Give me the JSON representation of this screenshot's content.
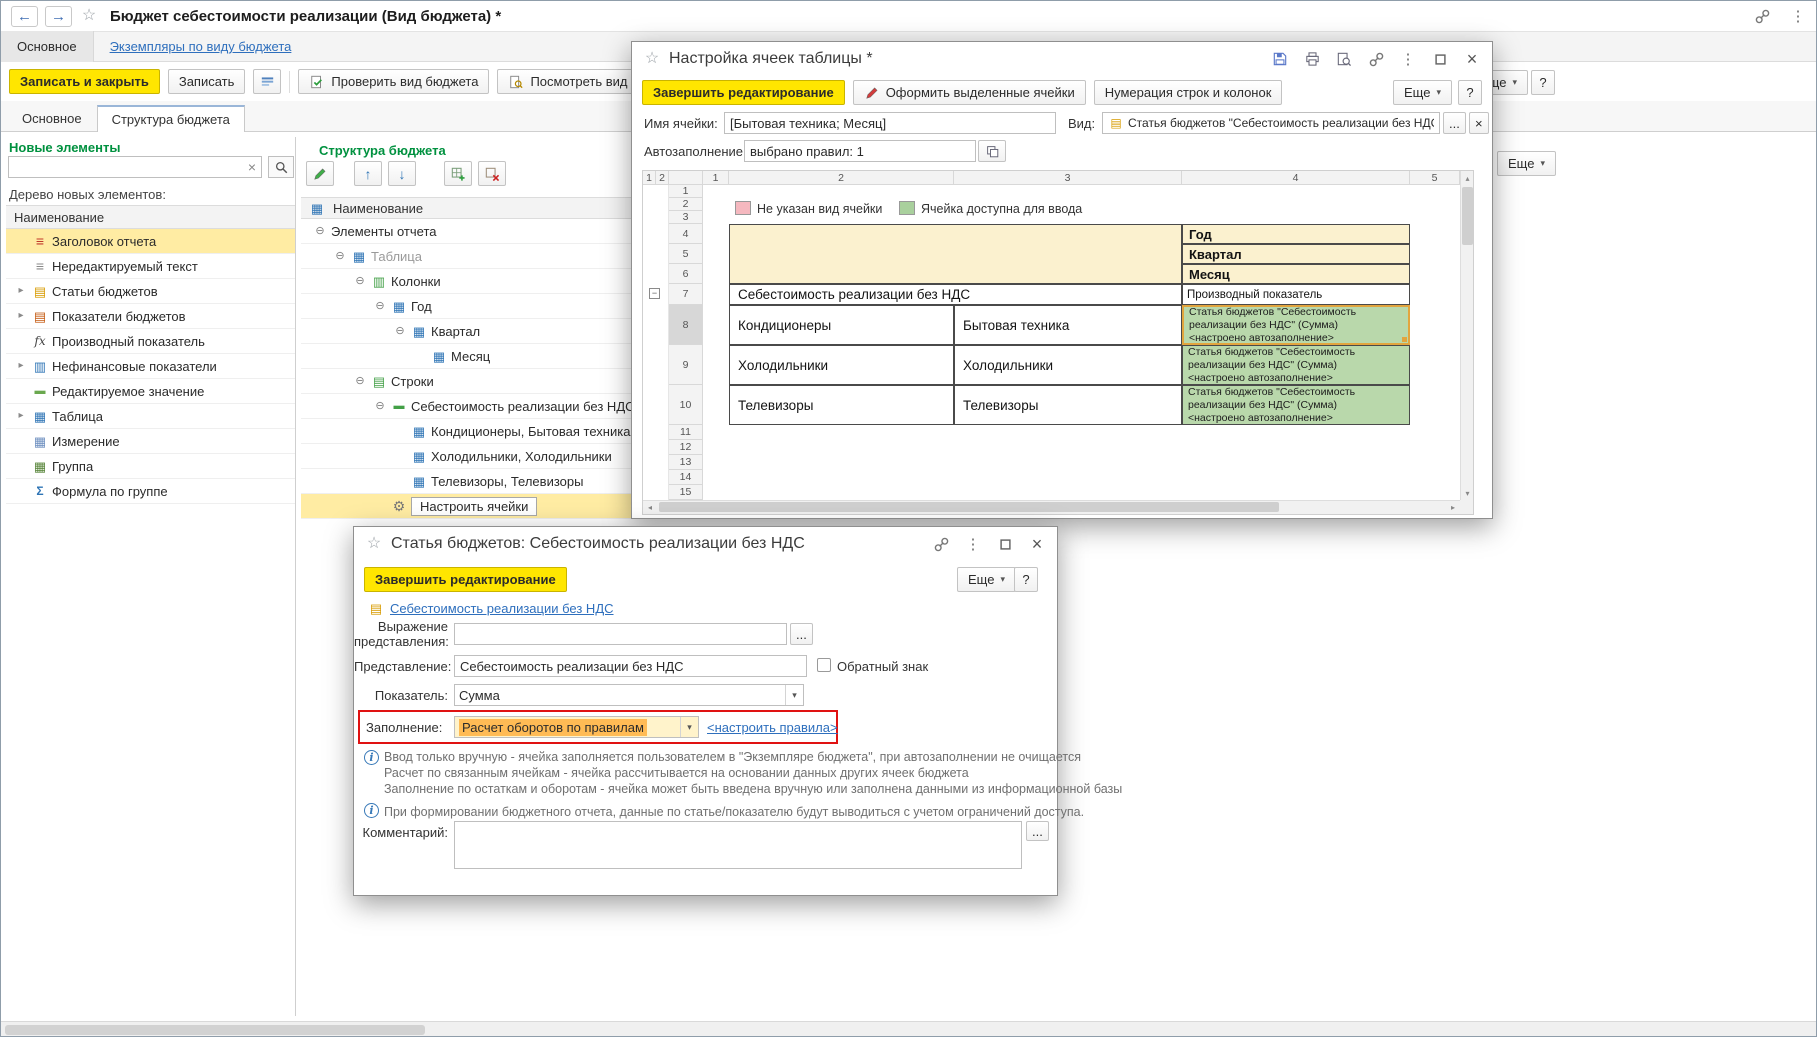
{
  "colors": {
    "accent_yellow": "#ffe600",
    "link_blue": "#2e6fbd",
    "section_green": "#00913f",
    "row_highlight": "#ffeca3",
    "cell_green": "#b9d8ab",
    "cell_pink": "#f5b8bf",
    "period_yellow": "#fbf1cf",
    "attention_red": "#e01212",
    "combo_highlight": "#ffbb55"
  },
  "icons": [
    "back-icon",
    "forward-icon",
    "star-icon",
    "link-icon",
    "menu-dots-icon",
    "search-icon",
    "clear-icon",
    "edit-pencil-icon",
    "move-up-icon",
    "move-down-icon",
    "add-row-icon",
    "delete-row-icon",
    "gear-icon",
    "save-icon",
    "print-icon",
    "preview-icon",
    "maximize-icon",
    "close-icon",
    "info-icon",
    "dropdown-icon",
    "copy-icon",
    "format-pencil-icon",
    "report-icon",
    "check-report-icon",
    "view-report-icon",
    "kind-field-icon",
    "expander-icon",
    "chevron-right-icon"
  ],
  "app": {
    "title": "Бюджет себестоимости реализации (Вид бюджета) *",
    "nav_tab": "Основное",
    "instances_link": "Экземпляры по виду бюджета",
    "toolbar": {
      "save_close": "Записать и закрыть",
      "save": "Записать",
      "check_budget": "Проверить вид бюджета",
      "view_report": "Посмотреть вид отчета",
      "more": "Еще",
      "help": "?"
    },
    "tab_main": "Основное",
    "tab_structure": "Структура бюджета"
  },
  "new_elements": {
    "title": "Новые элементы",
    "tree_caption": "Дерево новых элементов:",
    "column_header": "Наименование",
    "items": [
      {
        "label": "Заголовок отчета",
        "icon": "report-header-icon",
        "chevron": false,
        "selected": true
      },
      {
        "label": "Нередактируемый текст",
        "icon": "static-text-icon",
        "chevron": false,
        "selected": false
      },
      {
        "label": "Статьи бюджетов",
        "icon": "budget-articles-icon",
        "chevron": true,
        "selected": false
      },
      {
        "label": "Показатели бюджетов",
        "icon": "budget-indicators-icon",
        "chevron": true,
        "selected": false
      },
      {
        "label": "Производный показатель",
        "icon": "fx-icon",
        "chevron": false,
        "selected": false
      },
      {
        "label": "Нефинансовые показатели",
        "icon": "nonfinancial-icon",
        "chevron": true,
        "selected": false
      },
      {
        "label": "Редактируемое значение",
        "icon": "editable-value-icon",
        "chevron": false,
        "selected": false
      },
      {
        "label": "Таблица",
        "icon": "table-icon",
        "chevron": true,
        "selected": false
      },
      {
        "label": "Измерение",
        "icon": "dimension-icon",
        "chevron": false,
        "selected": false
      },
      {
        "label": "Группа",
        "icon": "group-icon",
        "chevron": false,
        "selected": false
      },
      {
        "label": "Формула по группе",
        "icon": "formula-icon",
        "chevron": false,
        "selected": false
      }
    ]
  },
  "budget_structure": {
    "title": "Структура бюджета",
    "column_header": "Наименование",
    "more": "Еще",
    "rows": [
      {
        "label": "Элементы отчета",
        "level": 0,
        "expander": true,
        "icon": "",
        "muted": false,
        "selected": false,
        "action_box": false
      },
      {
        "label": "Таблица",
        "level": 1,
        "expander": true,
        "icon": "table-icon",
        "muted": true,
        "selected": false,
        "action_box": false
      },
      {
        "label": "Колонки",
        "level": 2,
        "expander": true,
        "icon": "columns-icon",
        "muted": false,
        "selected": false,
        "action_box": false
      },
      {
        "label": "Год",
        "level": 3,
        "expander": true,
        "icon": "grid-icon",
        "muted": false,
        "selected": false,
        "action_box": false
      },
      {
        "label": "Квартал",
        "level": 4,
        "expander": true,
        "icon": "grid-icon",
        "muted": false,
        "selected": false,
        "action_box": false
      },
      {
        "label": "Месяц",
        "level": 5,
        "expander": false,
        "icon": "grid-icon",
        "muted": false,
        "selected": false,
        "action_box": false
      },
      {
        "label": "Строки",
        "level": 2,
        "expander": true,
        "icon": "rows-icon",
        "muted": false,
        "selected": false,
        "action_box": false
      },
      {
        "label": "Себестоимость реализации без НДС",
        "level": 3,
        "expander": true,
        "icon": "article-icon",
        "muted": false,
        "selected": false,
        "action_box": false
      },
      {
        "label": "Кондиционеры, Бытовая техника",
        "level": 4,
        "expander": false,
        "icon": "grid-icon",
        "muted": false,
        "selected": false,
        "action_box": false
      },
      {
        "label": "Холодильники, Холодильники",
        "level": 4,
        "expander": false,
        "icon": "grid-icon",
        "muted": false,
        "selected": false,
        "action_box": false
      },
      {
        "label": "Телевизоры, Телевизоры",
        "level": 4,
        "expander": false,
        "icon": "grid-icon",
        "muted": false,
        "selected": false,
        "action_box": false
      },
      {
        "label": "Настроить ячейки",
        "level": 3,
        "expander": false,
        "icon": "gear-icon",
        "muted": false,
        "selected": true,
        "action_box": true
      }
    ]
  },
  "cells_dialog": {
    "title": "Настройка ячеек таблицы *",
    "finish_button": "Завершить редактирование",
    "format_button": "Оформить выделенные ячейки",
    "numbering_button": "Нумерация строк и колонок",
    "more": "Еще",
    "help": "?",
    "cell_name_label": "Имя ячейки:",
    "cell_name_value": "[Бытовая техника; Месяц]",
    "kind_label": "Вид:",
    "kind_value": "Статья бюджетов \"Себестоимость реализации без НДС\"",
    "choose_button": "...",
    "clear_button": "×",
    "autofill_label": "Автозаполнение:",
    "autofill_value": "выбрано правил: 1",
    "legend": [
      {
        "label": "Не указан вид ячейки"
      },
      {
        "label": "Ячейка доступна для ввода"
      }
    ],
    "sheet": {
      "corner_levels": [
        "1",
        "2"
      ],
      "column_headers": [
        "1",
        "2",
        "3",
        "4",
        "5"
      ],
      "row_headers": [
        "1",
        "2",
        "3",
        "4",
        "5",
        "6",
        "7",
        "8",
        "9",
        "10",
        "11",
        "12",
        "13",
        "14",
        "15"
      ],
      "period_cells": [
        "Год",
        "Квартал",
        "Месяц"
      ],
      "article_row_label": "Себестоимость реализации без НДС",
      "article_row_indicator": "Производный показатель",
      "data_rows": [
        {
          "name": "Кондиционеры",
          "dimension": "Бытовая техника",
          "selected": true
        },
        {
          "name": "Холодильники",
          "dimension": "Холодильники",
          "selected": false
        },
        {
          "name": "Телевизоры",
          "dimension": "Телевизоры",
          "selected": false
        }
      ],
      "green_cell_lines": [
        "Статья бюджетов \"Себестоимость",
        "реализации без НДС\" (Сумма)",
        "<настроено автозаполнение>"
      ]
    }
  },
  "article_dialog": {
    "title": "Статья бюджетов: Себестоимость реализации без НДС",
    "finish_button": "Завершить редактирование",
    "more": "Еще",
    "help": "?",
    "article_link": "Себестоимость реализации без НДС",
    "expression_label_line1": "Выражение",
    "expression_label_line2": "представления:",
    "expression_value": "",
    "choose_button": "...",
    "presentation_label": "Представление:",
    "presentation_value": "Себестоимость реализации без НДС",
    "reverse_sign_label": "Обратный знак",
    "indicator_label": "Показатель:",
    "indicator_value": "Сумма",
    "filling_label": "Заполнение:",
    "filling_value": "Расчет оборотов по правилам",
    "configure_rules_link": "<настроить правила>",
    "info_lines": [
      "Ввод только вручную - ячейка заполняется пользователем в \"Экземпляре бюджета\", при автозаполнении не очищается",
      "Расчет по связанным ячейкам - ячейка рассчитывается на основании данных других ячеек бюджета",
      "Заполнение по остаткам и оборотам - ячейка может быть введена вручную или заполнена данными из информационной базы"
    ],
    "access_info": "При формировании бюджетного отчета, данные по статье/показателю будут выводиться с учетом ограничений доступа.",
    "comment_label": "Комментарий:",
    "comment_value": ""
  }
}
